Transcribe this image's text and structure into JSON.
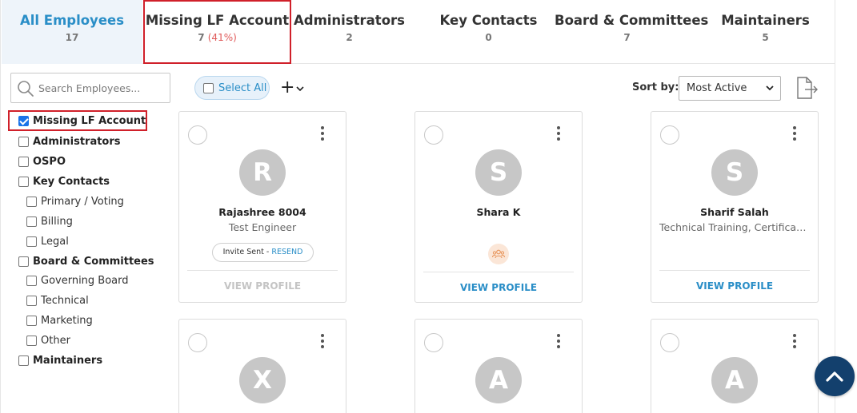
{
  "tabs": [
    {
      "label": "All Employees",
      "count": "17"
    },
    {
      "label": "Missing LF Account",
      "count": "7",
      "percent": "(41%)"
    },
    {
      "label": "Administrators",
      "count": "2"
    },
    {
      "label": "Key Contacts",
      "count": "0"
    },
    {
      "label": "Board & Committees",
      "count": "7"
    },
    {
      "label": "Maintainers",
      "count": "5"
    }
  ],
  "search": {
    "placeholder": "Search Employees..."
  },
  "filters": [
    {
      "label": "Missing LF Account",
      "checked": true
    },
    {
      "label": "Administrators"
    },
    {
      "label": "OSPO"
    },
    {
      "label": "Key Contacts"
    },
    {
      "label": "Primary / Voting"
    },
    {
      "label": "Billing"
    },
    {
      "label": "Legal"
    },
    {
      "label": "Board & Committees"
    },
    {
      "label": "Governing Board"
    },
    {
      "label": "Technical"
    },
    {
      "label": "Marketing"
    },
    {
      "label": "Other"
    },
    {
      "label": "Maintainers"
    }
  ],
  "toolbar": {
    "select_all": "Select All",
    "add_symbol": "+",
    "sort_label": "Sort by:",
    "sort_value": "Most Active"
  },
  "cards": [
    {
      "initial": "R",
      "name": "Rajashree 8004",
      "title": "Test Engineer",
      "invite_text": "Invite Sent - ",
      "resend": "RESEND",
      "view": "VIEW PROFILE"
    },
    {
      "initial": "S",
      "name": "Shara K",
      "title": "",
      "view": "VIEW PROFILE"
    },
    {
      "initial": "S",
      "name": "Sharif Salah",
      "title": "Technical Training, Certification",
      "view": "VIEW PROFILE"
    },
    {
      "initial": "X"
    },
    {
      "initial": "A"
    },
    {
      "initial": "A"
    }
  ],
  "colors": {
    "accent": "#2a8ec7",
    "highlight": "#d0202a",
    "scroll_button": "#13406d"
  }
}
